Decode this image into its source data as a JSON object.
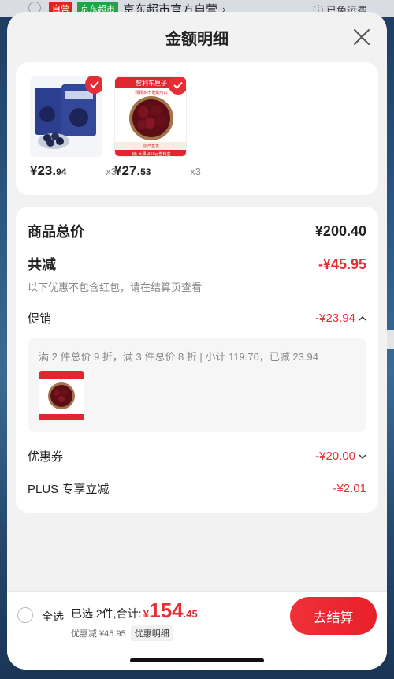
{
  "background_bar": {
    "tag_self": "自营",
    "tag_market": "京东超市",
    "store_name": "京东超市官方自营",
    "chevron": "›",
    "free_shipping": "已免运费"
  },
  "sheet": {
    "title": "金额明细"
  },
  "products": [
    {
      "name": "blueberry-pack",
      "price_main": "¥23.",
      "price_cents": "94",
      "qty": "x3"
    },
    {
      "name": "cherry-pack",
      "price_main": "¥27.",
      "price_cents": "53",
      "qty": "x3",
      "brand_label": "智利车厘子",
      "tagline": "颗颗多汁 脆甜可口",
      "origin": "原产直发",
      "spec": "J级 大果 450g 塑料盒"
    }
  ],
  "detail": {
    "subtotal_label": "商品总价",
    "subtotal_value": "¥200.40",
    "total_discount_label": "共减",
    "total_discount_value": "-¥45.95",
    "note": "以下优惠不包含红包，请在结算页查看",
    "promo_label": "促销",
    "promo_value": "-¥23.94",
    "promo_desc": "满 2 件总价 9 折，满 3 件总价 8 折 | 小计 119.70，已减 23.94",
    "coupon_label": "优惠券",
    "coupon_value": "-¥20.00",
    "plus_label": "PLUS 专享立减",
    "plus_value": "-¥2.01"
  },
  "bottom": {
    "select_all": "全选",
    "selected_text": "已选 2件,合计:",
    "currency": "¥",
    "total_int": "154",
    "total_dec": ".45",
    "discount_text": "优惠减:¥45.95",
    "detail_chip": "优惠明细",
    "checkout": "去结算"
  },
  "colors": {
    "accent_red": "#e52d35",
    "sheet_bg": "#f2f2f2"
  }
}
